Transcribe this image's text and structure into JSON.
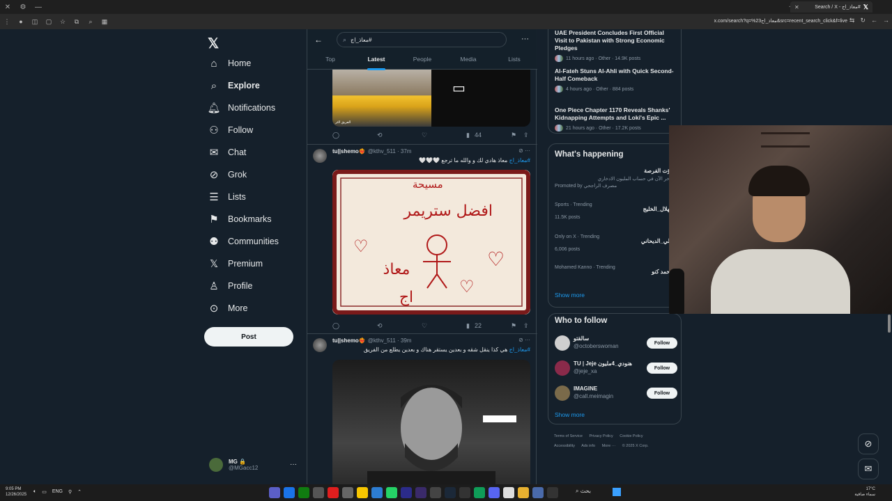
{
  "browser": {
    "tab_title": "Search / X - معاذ_اج#",
    "url": "x.com/search?q=%23معاذ_اج&src=recent_search_click&f=live"
  },
  "nav": {
    "items": [
      {
        "label": "Home",
        "icon": "home-icon"
      },
      {
        "label": "Explore",
        "icon": "search-icon"
      },
      {
        "label": "Notifications",
        "icon": "bell-icon"
      },
      {
        "label": "Follow",
        "icon": "person-plus-icon"
      },
      {
        "label": "Chat",
        "icon": "mail-icon"
      },
      {
        "label": "Grok",
        "icon": "grok-icon"
      },
      {
        "label": "Lists",
        "icon": "list-icon"
      },
      {
        "label": "Bookmarks",
        "icon": "bookmark-icon"
      },
      {
        "label": "Communities",
        "icon": "people-icon"
      },
      {
        "label": "Premium",
        "icon": "x-icon"
      },
      {
        "label": "Profile",
        "icon": "person-icon"
      },
      {
        "label": "More",
        "icon": "more-circle-icon"
      }
    ],
    "post_label": "Post",
    "account": {
      "name": "MG 🔒",
      "handle": "@MGacc12"
    }
  },
  "search": {
    "query": "معاذ_اج#"
  },
  "tabs": [
    "Top",
    "Latest",
    "People",
    "Media",
    "Lists"
  ],
  "media1_caption": "الفريق الثر",
  "tweets": [
    {
      "stats": {
        "views": "44"
      }
    },
    {
      "name": "tu||shemo❤️‍🔥",
      "handle": "@kthv_511 · 37m",
      "hashtag": "#معاذ_اج",
      "text": " معاذ هادي لك و والله ما ترجع 🤍🤍🤍",
      "views": "22",
      "drawing": {
        "banner": "مسيحة",
        "line1": "افضل ستريمر",
        "line2": "معاذ",
        "line3": "اج"
      }
    },
    {
      "name": "tu||shemo❤️‍🔥",
      "handle": "@kthv_511 · 39m",
      "hashtag": "#معاذ_اج",
      "text": " هي كذا ينقل شقه و بعدين يستقر هناك و بعدين يطلع من الفريق"
    }
  ],
  "news": [
    {
      "title": "UAE President Concludes First Official Visit to Pakistan with Strong Economic Pledges",
      "meta": "11 hours ago · Other · 14.9K posts"
    },
    {
      "title": "Al-Fateh Stuns Al-Ahli with Quick Second-Half Comeback",
      "meta": "4 hours ago · Other · 884 posts"
    },
    {
      "title": "One Piece Chapter 1170 Reveals Shanks' Kidnapping Attempts and Loki's Epic ...",
      "meta": "21 hours ago · Other · 17.2K posts"
    }
  ],
  "happening": {
    "title": "What's happening",
    "promo": {
      "title": "فوّت الفرصة",
      "sub": "ادخر الآن في حساب المليون الادخاري",
      "promoted": "Promoted by مصرف الراجحي"
    },
    "trends": [
      {
        "meta": "Sports · Trending",
        "name": "الهلال_الخليج",
        "posts": "11.5K posts"
      },
      {
        "meta": "Only on X · Trending",
        "name": "علي_الديحاني",
        "posts": "6,006 posts"
      },
      {
        "meta": "Mohamed Kanno · Trending",
        "name": "محمد كنو",
        "posts": ""
      }
    ],
    "show_more": "Show more"
  },
  "who_to_follow": {
    "title": "Who to follow",
    "users": [
      {
        "name": "سالقتو",
        "handle": "@octoberswoman",
        "button": "Follow"
      },
      {
        "name": "TU | Jeje هنودي_4مليون",
        "handle": "@jeje_xa",
        "button": "Follow"
      },
      {
        "name": "IMAGINE",
        "handle": "@call.meimagin",
        "button": "Follow"
      }
    ],
    "show_more": "Show more"
  },
  "footer": [
    "Terms of Service",
    "Privacy Policy",
    "Cookie Policy",
    "Accessibility",
    "Ads info",
    "More ···",
    "© 2025 X Corp."
  ],
  "taskbar": {
    "time": "9:05 PM",
    "date": "12/26/2025",
    "lang": "ENG",
    "search": "بحث",
    "weather_temp": "17°C",
    "weather_desc": "سماء صافية"
  },
  "colors": {
    "accent": "#1d9bf0",
    "bg": "#15202b",
    "border": "#38444d"
  }
}
